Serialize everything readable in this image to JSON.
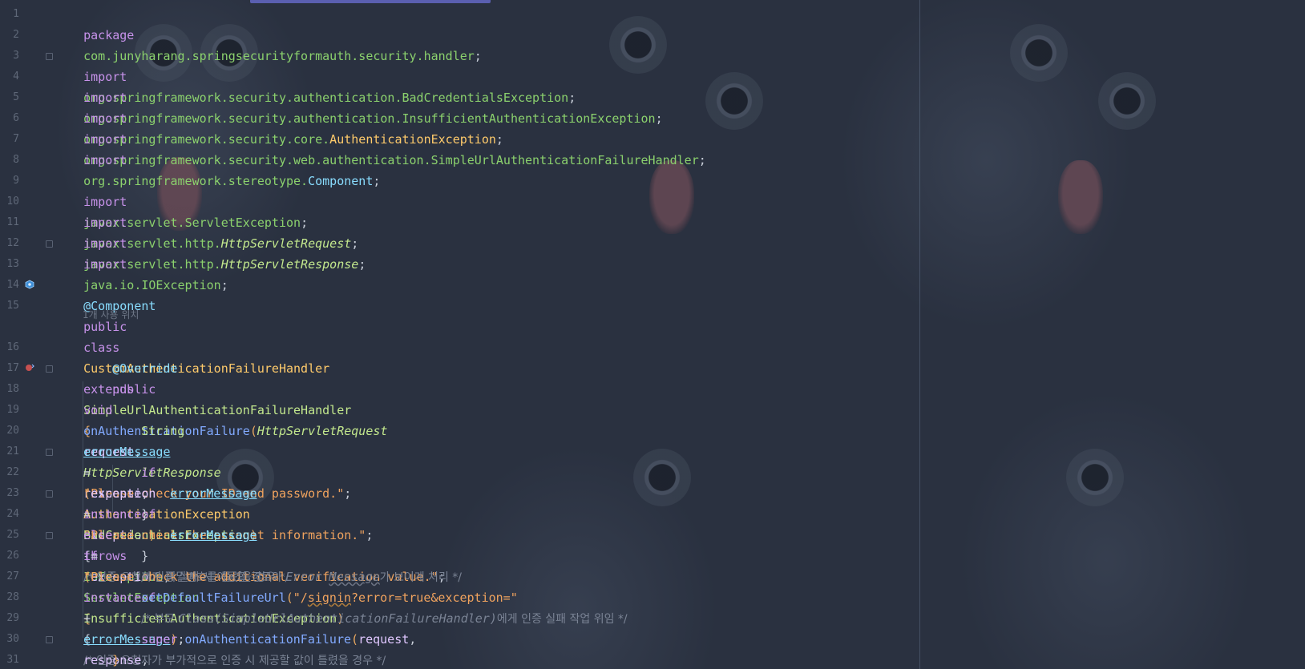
{
  "editor": {
    "line_numbers": [
      "1",
      "2",
      "3",
      "4",
      "5",
      "6",
      "7",
      "8",
      "9",
      "10",
      "11",
      "12",
      "13",
      "14",
      "15",
      "16",
      "17",
      "18",
      "19",
      "20",
      "21",
      "22",
      "23",
      "24",
      "25",
      "26",
      "27",
      "28",
      "29",
      "30",
      "31"
    ],
    "usage_hint": "1개 사용 위치",
    "code": {
      "l1_kw": "package",
      "l1_pkg": "com.junyharang.springsecurityformauth.security.handler",
      "import_kw": "import",
      "l3_pkg": "org.springframework.security.authentication.",
      "l3_cls": "BadCredentialsException",
      "l4_pkg": "org.springframework.security.authentication.",
      "l4_cls": "InsufficientAuthenticationException",
      "l5_pkg": "org.springframework.security.core.",
      "l5_cls": "AuthenticationException",
      "l6_pkg": "org.springframework.security.web.authentication.",
      "l6_cls": "SimpleUrlAuthenticationFailureHandler",
      "l7_pkg": "org.springframework.stereotype.",
      "l7_cls": "Component",
      "l9_pkg": "javax.servlet.",
      "l9_cls": "ServletException",
      "l10_pkg": "javax.servlet.http.",
      "l10_cls": "HttpServletRequest",
      "l11_pkg": "javax.servlet.http.",
      "l11_cls": "HttpServletResponse",
      "l12_pkg": "java.io.",
      "l12_cls": "IOException",
      "semi": ";",
      "l14_ann": "@Component",
      "l14_kw1": "public",
      "l14_kw2": "class",
      "l14_name": "CustomAuthenticationFailureHandler",
      "l14_kw3": "extends",
      "l14_super": "SimpleUrlAuthenticationFailureHandler",
      "l14_brace": "{",
      "l16_ann": "@Override",
      "l17_kw1": "public",
      "l17_kw2": "void",
      "l17_fn": "onAuthenticationFailure",
      "l17_t1": "HttpServletRequest",
      "l17_p1": "request",
      "l17_t2": "HttpServletResponse",
      "l17_p2": "response",
      "l17_t3": "AuthenticationException",
      "l17_p3": "exception",
      "l17_throws": "throws",
      "l17_e1": "IOException",
      "l17_e2": "ServletException",
      "l17_brace": "{",
      "l19_type": "String",
      "err_var": "errorMessage",
      "l19_str": "\"Please check your ID and password.\"",
      "l21_if": "if",
      "exc": "exception",
      "instanceof": "instanceof",
      "l21_cls": "BadCredentialsException",
      "l21_cmt": "/* 인증 요청자가 비밀번호를 틀렸을 경우 */",
      "l22_str": "\"Please check the account information.\"",
      "l23_else": "else",
      "l23_if": "if",
      "l23_cls": "InsufficientAuthenticationException",
      "l23_cmt": "/* 인증 요청자가 부가적으로 인증 시 제공할 값이 틀렸을 경우 */",
      "l24_str": "\"Please check the additional verification value.\"",
      "l26_cmt_a": "/* 인증 실패 시 이동할 경로와 ",
      "l26_cmt_b": "Error ",
      "l26_cmt_c": "Message",
      "l26_cmt_d": "가 보이게 처리 */",
      "l27_fn": "setDefaultFailureUrl",
      "l27_str_a": "\"/",
      "l27_str_b": "signin",
      "l27_str_c": "?error=true&exception=\"",
      "l27_plus": "+",
      "l28_cmt_a": "/* 부모 ",
      "l28_cmt_b": "Class(SimpleUrlAuthenticationFailureHandler)",
      "l28_cmt_c": "에게 인증 실패 작업 위임 */",
      "l29_super": "super",
      "l29_fn": "onAuthenticationFailure",
      "l29_a1": "request",
      "l29_a2": "response",
      "l29_a3": "exception",
      "close_brace": "}"
    }
  }
}
